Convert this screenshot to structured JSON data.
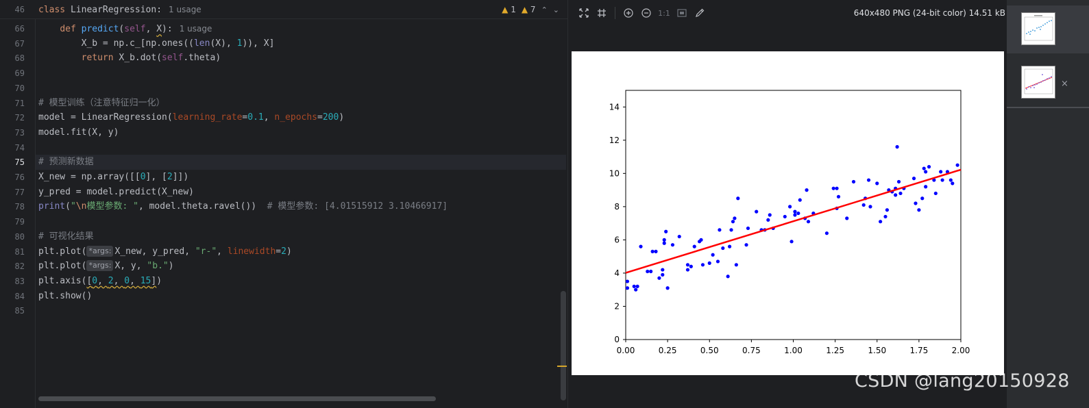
{
  "editor": {
    "sticky_header": {
      "line_no": "46",
      "keyword": "class",
      "class_name": " LinearRegression:",
      "usage": "1 usage"
    },
    "inspection": {
      "warnings": "1",
      "weak_warnings": "7"
    },
    "lines": [
      {
        "no": "66",
        "html": "    <span class='kw'>def</span> <span class='fn'>predict</span>(<span class='self'>self</span>, <span class='warn-ul'>X</span>):<span class='usage'>1 usage</span>"
      },
      {
        "no": "67",
        "html": "        X_b = np.c_[np.ones((<span class='fn2'>len</span>(X), <span class='num'>1</span>)), X]"
      },
      {
        "no": "68",
        "html": "        <span class='kw'>return</span> X_b.dot(<span class='self'>self</span>.theta)"
      },
      {
        "no": "69",
        "html": ""
      },
      {
        "no": "70",
        "html": ""
      },
      {
        "no": "71",
        "html": "<span class='cmt'># 模型训练（注意特征归一化）</span>"
      },
      {
        "no": "72",
        "html": "model = LinearRegression(<span class='param'>learning_rate</span>=<span class='num'>0.1</span>, <span class='param'>n_epochs</span>=<span class='num'>200</span>)"
      },
      {
        "no": "73",
        "html": "model.fit(X, y)"
      },
      {
        "no": "74",
        "html": ""
      },
      {
        "no": "75",
        "html": "<span class='cmt'># 预测新数据</span>"
      },
      {
        "no": "76",
        "html": "X_new = np.array([[<span class='num'>0</span>], [<span class='num'>2</span>]])"
      },
      {
        "no": "77",
        "html": "y_pred = model.predict(X_new)"
      },
      {
        "no": "78",
        "html": "<span class='fn2'>print</span>(<span class='str'>\"<span class='esc'>\\n</span>模型参数: \"</span>, model.theta.ravel())  <span class='cmt'># 模型参数: [4.01515912 3.10466917]</span>"
      },
      {
        "no": "79",
        "html": ""
      },
      {
        "no": "80",
        "html": "<span class='cmt'># 可视化结果</span>"
      },
      {
        "no": "81",
        "html": "plt.plot(<span class='hint'>*args:</span>X_new, y_pred, <span class='str'>\"r-\"</span>, <span class='param'>linewidth</span>=<span class='num'>2</span>)"
      },
      {
        "no": "82",
        "html": "plt.plot(<span class='hint'>*args:</span>X, y, <span class='str'>\"b.\"</span>)"
      },
      {
        "no": "83",
        "html": "plt.axis(<span class='warn-ul'>[<span class='num'>0</span>, <span class='num'>2</span>, <span class='num'>0</span>, <span class='num'>15</span>]</span>)"
      },
      {
        "no": "84",
        "html": "plt.show()"
      },
      {
        "no": "85",
        "html": ""
      }
    ],
    "current_line": "75"
  },
  "viewer": {
    "image_info": "640x480 PNG (24-bit color) 14.51 kB",
    "toolbar": [
      "fit-icon",
      "grid-icon",
      "zoom-in-icon",
      "zoom-out-icon",
      "actual-size",
      "background-icon",
      "color-picker-icon"
    ],
    "actual_size_label": "1:1"
  },
  "thumbnails": {
    "close_glyph": "×"
  },
  "watermark": "CSDN @lang20150928",
  "colors": {
    "scatter": "#0000ff",
    "fit_line": "#ff0000",
    "editor_bg": "#1e1f22"
  },
  "chart_data": {
    "type": "scatter",
    "title": "",
    "xlabel": "",
    "ylabel": "",
    "xlim": [
      0,
      2
    ],
    "ylim": [
      0,
      15
    ],
    "x_ticks": [
      "0.00",
      "0.25",
      "0.50",
      "0.75",
      "1.00",
      "1.25",
      "1.50",
      "1.75",
      "2.00"
    ],
    "y_ticks": [
      "0",
      "2",
      "4",
      "6",
      "8",
      "10",
      "12",
      "14"
    ],
    "grid": false,
    "series": [
      {
        "type": "line",
        "color": "#ff0000",
        "x": [
          0,
          2
        ],
        "y": [
          4.01515912,
          10.22449746
        ]
      },
      {
        "type": "scatter",
        "color": "#0000ff",
        "points": [
          [
            0.01,
            3.1
          ],
          [
            0.01,
            3.5
          ],
          [
            0.05,
            3.2
          ],
          [
            0.06,
            3.0
          ],
          [
            0.07,
            3.2
          ],
          [
            0.09,
            5.6
          ],
          [
            0.13,
            4.1
          ],
          [
            0.15,
            4.1
          ],
          [
            0.16,
            5.3
          ],
          [
            0.18,
            5.3
          ],
          [
            0.2,
            3.7
          ],
          [
            0.22,
            3.9
          ],
          [
            0.22,
            4.2
          ],
          [
            0.23,
            5.8
          ],
          [
            0.23,
            6.0
          ],
          [
            0.24,
            6.5
          ],
          [
            0.25,
            3.1
          ],
          [
            0.28,
            5.7
          ],
          [
            0.32,
            6.2
          ],
          [
            0.37,
            4.5
          ],
          [
            0.37,
            4.2
          ],
          [
            0.39,
            4.4
          ],
          [
            0.41,
            5.6
          ],
          [
            0.44,
            5.9
          ],
          [
            0.45,
            6.0
          ],
          [
            0.46,
            4.5
          ],
          [
            0.5,
            4.6
          ],
          [
            0.52,
            5.1
          ],
          [
            0.55,
            4.7
          ],
          [
            0.56,
            6.6
          ],
          [
            0.58,
            5.5
          ],
          [
            0.61,
            3.8
          ],
          [
            0.62,
            5.6
          ],
          [
            0.63,
            6.6
          ],
          [
            0.64,
            7.1
          ],
          [
            0.65,
            7.3
          ],
          [
            0.66,
            4.5
          ],
          [
            0.67,
            8.5
          ],
          [
            0.72,
            5.7
          ],
          [
            0.73,
            6.7
          ],
          [
            0.78,
            7.7
          ],
          [
            0.81,
            6.6
          ],
          [
            0.83,
            6.6
          ],
          [
            0.85,
            7.2
          ],
          [
            0.86,
            7.5
          ],
          [
            0.88,
            6.7
          ],
          [
            0.95,
            7.4
          ],
          [
            0.98,
            8.0
          ],
          [
            0.99,
            5.9
          ],
          [
            1.01,
            7.7
          ],
          [
            1.01,
            7.5
          ],
          [
            1.03,
            7.6
          ],
          [
            1.04,
            8.4
          ],
          [
            1.07,
            7.3
          ],
          [
            1.08,
            9.0
          ],
          [
            1.09,
            7.1
          ],
          [
            1.12,
            7.6
          ],
          [
            1.2,
            6.4
          ],
          [
            1.24,
            9.1
          ],
          [
            1.26,
            9.1
          ],
          [
            1.26,
            7.9
          ],
          [
            1.27,
            8.6
          ],
          [
            1.32,
            7.3
          ],
          [
            1.36,
            9.5
          ],
          [
            1.42,
            8.1
          ],
          [
            1.43,
            8.5
          ],
          [
            1.45,
            9.6
          ],
          [
            1.46,
            8.0
          ],
          [
            1.5,
            9.4
          ],
          [
            1.52,
            7.1
          ],
          [
            1.55,
            7.4
          ],
          [
            1.56,
            7.8
          ],
          [
            1.57,
            9.0
          ],
          [
            1.59,
            8.9
          ],
          [
            1.61,
            9.1
          ],
          [
            1.61,
            8.7
          ],
          [
            1.62,
            11.6
          ],
          [
            1.63,
            9.5
          ],
          [
            1.64,
            8.8
          ],
          [
            1.66,
            9.1
          ],
          [
            1.72,
            9.7
          ],
          [
            1.73,
            8.2
          ],
          [
            1.75,
            7.8
          ],
          [
            1.77,
            8.5
          ],
          [
            1.78,
            10.3
          ],
          [
            1.79,
            9.2
          ],
          [
            1.79,
            10.1
          ],
          [
            1.81,
            10.4
          ],
          [
            1.84,
            9.6
          ],
          [
            1.85,
            8.8
          ],
          [
            1.88,
            10.1
          ],
          [
            1.89,
            9.6
          ],
          [
            1.92,
            10.1
          ],
          [
            1.94,
            9.6
          ],
          [
            1.95,
            9.4
          ],
          [
            1.98,
            10.5
          ]
        ]
      }
    ]
  }
}
